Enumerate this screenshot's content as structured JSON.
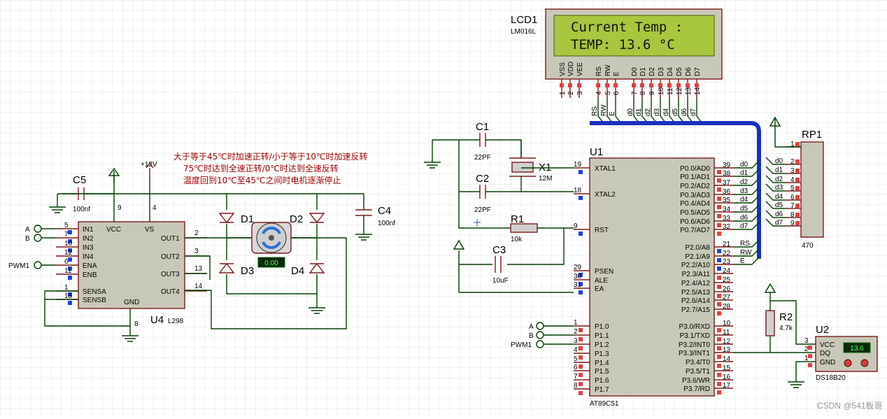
{
  "lcd": {
    "ref": "LCD1",
    "part": "LM016L",
    "line1": "Current Temp :",
    "line2": "TEMP:  13.6 °C",
    "pins": [
      "VSS",
      "VDD",
      "VEE",
      "RS",
      "RW",
      "E",
      "D0",
      "D1",
      "D2",
      "D3",
      "D4",
      "D5",
      "D6",
      "D7"
    ],
    "nums": [
      "1",
      "2",
      "3",
      "4",
      "5",
      "6",
      "7",
      "8",
      "9",
      "10",
      "11",
      "12",
      "13",
      "14"
    ],
    "nets": [
      "RS",
      "RW",
      "E",
      "d0",
      "d1",
      "d2",
      "d3",
      "d4",
      "d5",
      "d6",
      "d7"
    ]
  },
  "note": {
    "line1": "大于等于45℃时加速正转/小于等于10℃时加速反转",
    "line2": "75℃时达到全速正转/0℃时达到全速反转",
    "line3": "温度回到10℃至45℃之间时电机逐渐停止"
  },
  "u4": {
    "ref": "U4",
    "part": "L298",
    "supply": "+12V",
    "left_pins": [
      {
        "n": "5",
        "name": "IN1"
      },
      {
        "n": "7",
        "name": "IN2"
      },
      {
        "n": "10",
        "name": "IN3"
      },
      {
        "n": "12",
        "name": "IN4"
      },
      {
        "n": "6",
        "name": "ENA"
      },
      {
        "n": "11",
        "name": "ENB"
      },
      {
        "n": "1",
        "name": "SENSA"
      },
      {
        "n": "15",
        "name": "SENSB"
      }
    ],
    "right_pins": [
      {
        "n": "2",
        "name": "OUT1"
      },
      {
        "n": "3",
        "name": "OUT2"
      },
      {
        "n": "13",
        "name": "OUT3"
      },
      {
        "n": "14",
        "name": "OUT4"
      }
    ],
    "top": {
      "vcc": "VCC",
      "vs": "VS",
      "n9": "9",
      "n4": "4"
    },
    "gnd": "GND",
    "n8": "8",
    "inputs": {
      "a": "A",
      "b": "B",
      "pwm": "PWM1"
    }
  },
  "c5": {
    "ref": "C5",
    "val": "100nf"
  },
  "c4": {
    "ref": "C4",
    "val": "100nf"
  },
  "diodes": [
    "D1",
    "D2",
    "D3",
    "D4"
  ],
  "motor": {
    "value": "0.00"
  },
  "c1": {
    "ref": "C1",
    "val": "22PF"
  },
  "c2": {
    "ref": "C2",
    "val": "22PF"
  },
  "x1": {
    "ref": "X1",
    "val": "12M"
  },
  "r1": {
    "ref": "R1",
    "val": "10k"
  },
  "c3": {
    "ref": "C3",
    "val": "10uF"
  },
  "u1": {
    "ref": "U1",
    "part": "AT89C51",
    "left_pins": [
      {
        "n": "19",
        "name": "XTAL1"
      },
      {
        "n": "18",
        "name": "XTAL2"
      },
      {
        "n": "9",
        "name": "RST"
      },
      {
        "n": "29",
        "name": "PSEN"
      },
      {
        "n": "30",
        "name": "ALE"
      },
      {
        "n": "31",
        "name": "EA"
      },
      {
        "n": "1",
        "name": "P1.0"
      },
      {
        "n": "2",
        "name": "P1.1"
      },
      {
        "n": "3",
        "name": "P1.2"
      },
      {
        "n": "4",
        "name": "P1.3"
      },
      {
        "n": "5",
        "name": "P1.4"
      },
      {
        "n": "6",
        "name": "P1.5"
      },
      {
        "n": "7",
        "name": "P1.6"
      },
      {
        "n": "8",
        "name": "P1.7"
      }
    ],
    "p0": [
      {
        "n": "39",
        "name": "P0.0/AD0"
      },
      {
        "n": "38",
        "name": "P0.1/AD1"
      },
      {
        "n": "37",
        "name": "P0.2/AD2"
      },
      {
        "n": "36",
        "name": "P0.3/AD3"
      },
      {
        "n": "35",
        "name": "P0.4/AD4"
      },
      {
        "n": "34",
        "name": "P0.5/AD5"
      },
      {
        "n": "33",
        "name": "P0.6/AD6"
      },
      {
        "n": "32",
        "name": "P0.7/AD7"
      }
    ],
    "p2": [
      {
        "n": "21",
        "name": "P2.0/A8"
      },
      {
        "n": "22",
        "name": "P2.1/A9"
      },
      {
        "n": "23",
        "name": "P2.2/A10"
      },
      {
        "n": "24",
        "name": "P2.3/A11"
      },
      {
        "n": "25",
        "name": "P2.4/A12"
      },
      {
        "n": "26",
        "name": "P2.5/A13"
      },
      {
        "n": "27",
        "name": "P2.6/A14"
      },
      {
        "n": "28",
        "name": "P2.7/A15"
      }
    ],
    "p3": [
      {
        "n": "10",
        "name": "P3.0/RXD"
      },
      {
        "n": "11",
        "name": "P3.1/TXD"
      },
      {
        "n": "12",
        "name": "P3.2/INT0"
      },
      {
        "n": "13",
        "name": "P3.3/INT1"
      },
      {
        "n": "14",
        "name": "P3.4/T0"
      },
      {
        "n": "15",
        "name": "P3.5/T1"
      },
      {
        "n": "16",
        "name": "P3.6/WR"
      },
      {
        "n": "17",
        "name": "P3.7/RD"
      }
    ],
    "p0nets": [
      "d0",
      "d1",
      "d2",
      "d3",
      "d4",
      "d5",
      "d6",
      "d7"
    ],
    "p2nets": [
      "RS",
      "RW",
      "E"
    ],
    "inputs": {
      "a": "A",
      "b": "B",
      "pwm": "PWM1"
    }
  },
  "rp1": {
    "ref": "RP1",
    "val": "470",
    "nums": [
      "1",
      "2",
      "3",
      "4",
      "5",
      "6",
      "7",
      "8",
      "9"
    ],
    "nets": [
      "d0",
      "d1",
      "d2",
      "d3",
      "d4",
      "d5",
      "d6",
      "d7"
    ]
  },
  "r2": {
    "ref": "R2",
    "val": "4.7k"
  },
  "u2": {
    "ref": "U2",
    "part": "DS18B20",
    "reading": "13.6",
    "pins": [
      {
        "n": "3",
        "name": "VCC"
      },
      {
        "n": "2",
        "name": "DQ"
      },
      {
        "n": "1",
        "name": "GND"
      }
    ]
  },
  "watermark": "CSDN @541板哥"
}
